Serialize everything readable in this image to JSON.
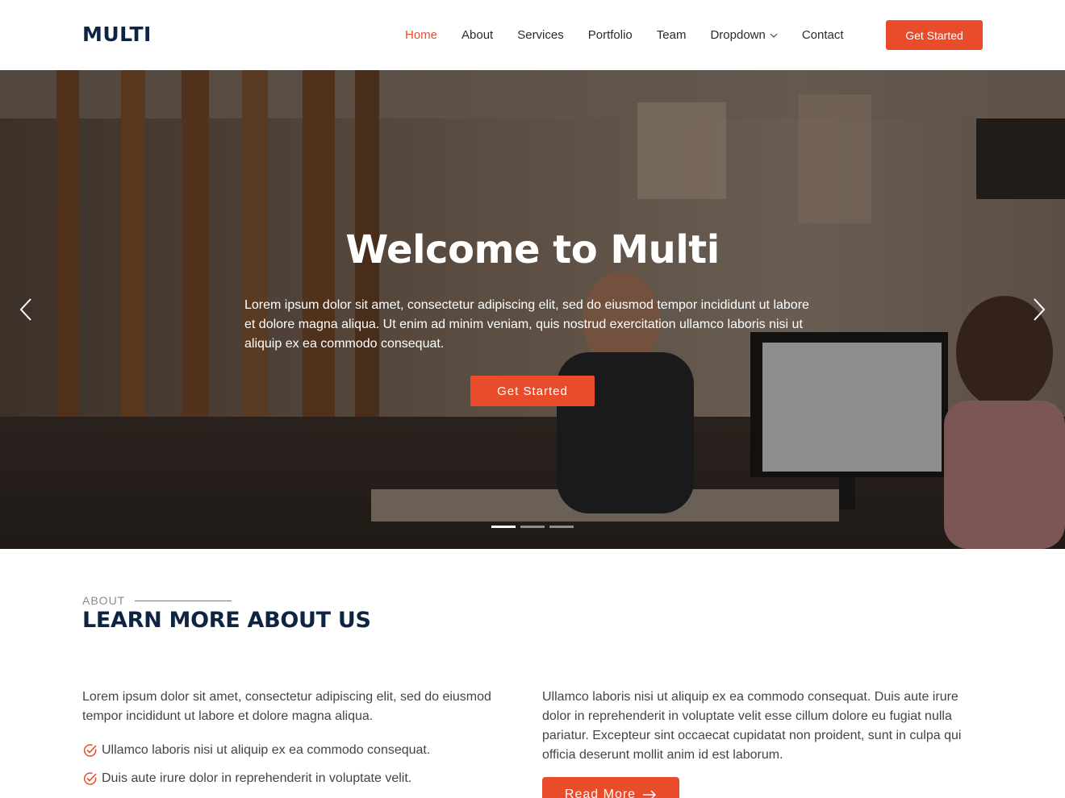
{
  "header": {
    "logo": "MULTI",
    "nav": {
      "home": "Home",
      "about": "About",
      "services": "Services",
      "portfolio": "Portfolio",
      "team": "Team",
      "dropdown": "Dropdown",
      "contact": "Contact"
    },
    "cta": "Get Started"
  },
  "hero": {
    "title": "Welcome to Multi",
    "text": "Lorem ipsum dolor sit amet, consectetur adipiscing elit, sed do eiusmod tempor incididunt ut labore et dolore magna aliqua. Ut enim ad minim veniam, quis nostrud exercitation ullamco laboris nisi ut aliquip ex ea commodo consequat.",
    "button": "Get Started",
    "slide_count": 3,
    "active_slide": 1
  },
  "about": {
    "label": "ABOUT",
    "title": "LEARN MORE ABOUT US",
    "left_paragraph": "Lorem ipsum dolor sit amet, consectetur adipiscing elit, sed do eiusmod tempor incididunt ut labore et dolore magna aliqua.",
    "checklist": [
      "Ullamco laboris nisi ut aliquip ex ea commodo consequat.",
      "Duis aute irure dolor in reprehenderit in voluptate velit."
    ],
    "right_paragraph": "Ullamco laboris nisi ut aliquip ex ea commodo consequat. Duis aute irure dolor in reprehenderit in voluptate velit esse cillum dolore eu fugiat nulla pariatur. Excepteur sint occaecat cupidatat non proident, sunt in culpa qui officia deserunt mollit anim id est laborum.",
    "read_more": "Read More"
  },
  "colors": {
    "accent": "#e84c2b",
    "heading": "#0e2442"
  },
  "icons": {
    "prev": "chevron-left-icon",
    "next": "chevron-right-icon",
    "dropdown": "chevron-down-icon",
    "check": "check-circle-icon",
    "arrow": "arrow-right-icon"
  }
}
